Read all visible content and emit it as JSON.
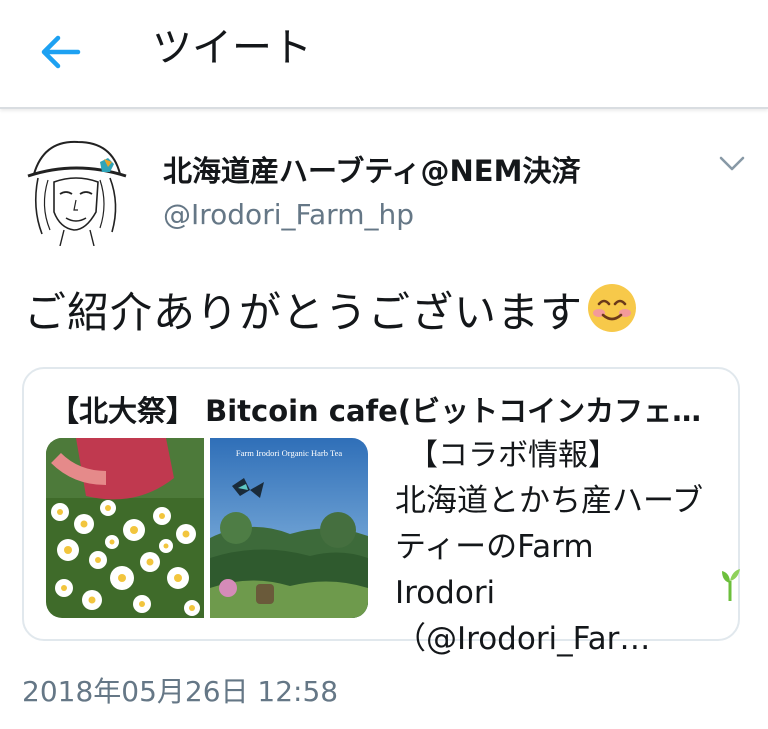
{
  "header": {
    "title": "ツイート"
  },
  "tweet": {
    "display_name": "北海道産ハーブティ@NEM決済",
    "handle": "@Irodori_Farm_hp",
    "text": "ご紹介ありがとうございます",
    "emoji": "smiling-face-emoji",
    "timestamp": "2018年05月26日 12:58"
  },
  "card": {
    "title": "【北大祭】 Bitcoin cafe(ビットコインカフェ…",
    "subtitle": "【コラボ情報】",
    "description_lines": [
      "北海道とかち産ハーブ",
      "ティーのFarm",
      "Irodori（@Irodori_Far…"
    ],
    "image_caption": "Farm Irodori Organic Harb Tea"
  },
  "colors": {
    "accent": "#1da1f2",
    "secondary_text": "#657786",
    "border": "#e1e8ed"
  }
}
